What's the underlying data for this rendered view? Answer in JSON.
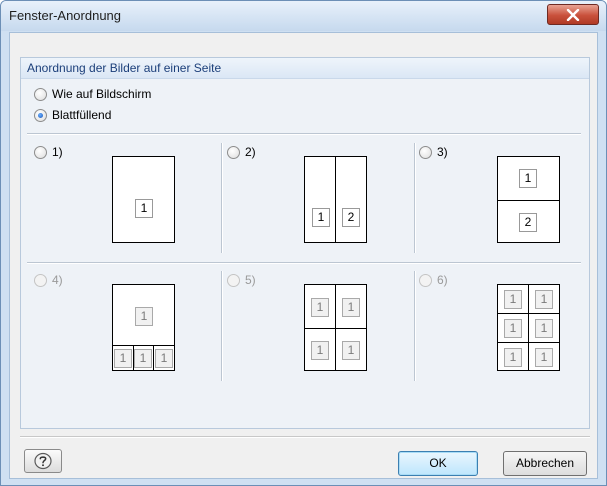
{
  "window": {
    "title": "Fenster-Anordnung",
    "close_label": "x"
  },
  "group": {
    "title": "Anordnung der Bilder auf einer Seite",
    "mode_options": [
      {
        "label": "Wie auf Bildschirm",
        "checked": false
      },
      {
        "label": "Blattfüllend",
        "checked": true
      }
    ]
  },
  "layouts": [
    {
      "label": "1)",
      "checked": false,
      "enabled": true,
      "cells": [
        "1"
      ]
    },
    {
      "label": "2)",
      "checked": false,
      "enabled": true,
      "cells": [
        "1",
        "2"
      ]
    },
    {
      "label": "3)",
      "checked": false,
      "enabled": true,
      "cells": [
        "1",
        "2"
      ]
    },
    {
      "label": "4)",
      "checked": false,
      "enabled": false,
      "cells": [
        "1",
        "1",
        "1",
        "1"
      ]
    },
    {
      "label": "5)",
      "checked": false,
      "enabled": false,
      "cells": [
        "1",
        "1",
        "1",
        "1"
      ]
    },
    {
      "label": "6)",
      "checked": false,
      "enabled": false,
      "cells": [
        "1",
        "1",
        "1",
        "1",
        "1",
        "1"
      ]
    }
  ],
  "footer": {
    "help_icon": "help-icon",
    "ok_label": "OK",
    "cancel_label": "Abbrechen"
  }
}
